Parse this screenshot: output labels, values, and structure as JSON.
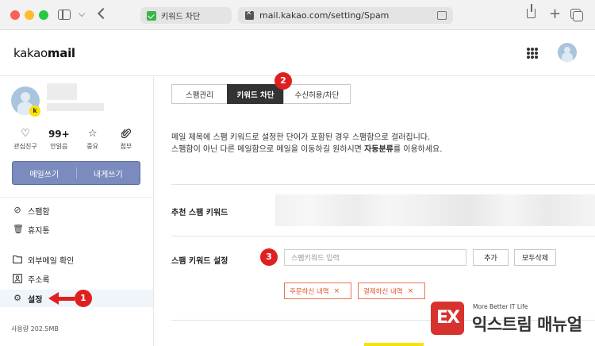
{
  "browser": {
    "tab_title": "키워드 차단",
    "url": "mail.kakao.com/setting/Spam"
  },
  "app": {
    "logo_light": "kakao",
    "logo_bold": "mail"
  },
  "profile": {
    "badge": "k",
    "quick": [
      {
        "icon": "heart-icon",
        "glyph": "♡",
        "label": "관심친구"
      },
      {
        "number": "99+",
        "label": "안읽음"
      },
      {
        "icon": "star-icon",
        "glyph": "☆",
        "label": "중요"
      },
      {
        "icon": "paperclip-icon",
        "glyph": "📎",
        "label": "첨부"
      }
    ],
    "compose_label": "메일쓰기",
    "self_compose_label": "내게쓰기"
  },
  "nav": {
    "items": [
      {
        "label": "스팸함",
        "icon": "block-icon"
      },
      {
        "label": "휴지통",
        "icon": "trash-icon"
      },
      {
        "label": "외부메일 확인",
        "icon": "folder-icon"
      },
      {
        "label": "주소록",
        "icon": "contacts-icon"
      },
      {
        "label": "설정",
        "icon": "gear-icon",
        "active": true
      }
    ],
    "storage": "사용량 202.5MB"
  },
  "settings": {
    "tabs": [
      {
        "label": "스팸관리"
      },
      {
        "label": "키워드 차단",
        "active": true
      },
      {
        "label": "수신허용/차단"
      }
    ],
    "desc_line1": "메일 제목에 스팸 키워드로 설정한 단어가 포함된 경우 스팸함으로 걸러집니다.",
    "desc_line2_pre": "스팸함이 아닌 다른 메일함으로 메일을 이동하길 원하시면 ",
    "desc_line2_bold": "자동분류",
    "desc_line2_post": "를 이용하세요.",
    "recommended_label": "추천 스팸 키워드",
    "keyword_setting_label": "스팸 키워드 설정",
    "keyword_placeholder": "스팸키워드 입력",
    "add_button": "추가",
    "delete_all_button": "모두삭제",
    "keywords": [
      "주문하신 내역",
      "결제하신 내역"
    ]
  },
  "annotations": [
    "1",
    "2",
    "3"
  ],
  "watermark": {
    "logo": "EX",
    "tagline": "More Better IT Life",
    "name": "익스트림 매뉴얼"
  },
  "colors": {
    "accent_red": "#e02020",
    "compose_button": "#7b8bbd",
    "chip_orange": "#e0562c",
    "kakao_yellow": "#f7e200"
  }
}
